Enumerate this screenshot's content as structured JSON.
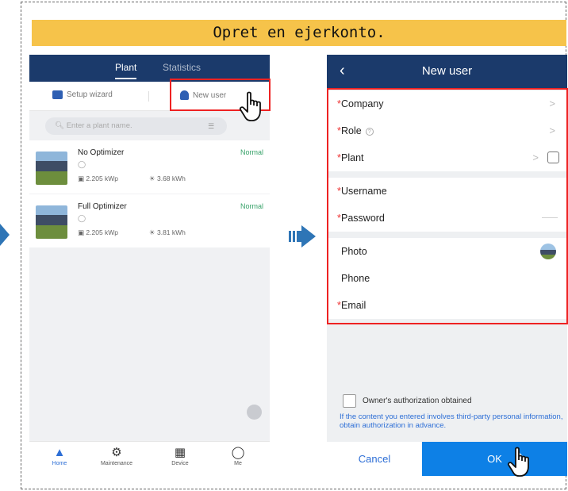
{
  "banner": {
    "title": "Opret en ejerkonto."
  },
  "colors": {
    "accent": "#1b3a6b",
    "highlight": "#e22222",
    "banner": "#f6c34a",
    "primary": "#0d80e6",
    "status_ok": "#3aa36b"
  },
  "plant_screen": {
    "tabs": [
      "Plant",
      "Statistics"
    ],
    "setup_wizard": "Setup wizard",
    "new_user": "New user",
    "search_placeholder": "Enter a plant name.",
    "plants": [
      {
        "name": "No Optimizer",
        "status": "Normal",
        "capacity": "2.205 kWp",
        "energy": "3.68 kWh"
      },
      {
        "name": "Full Optimizer",
        "status": "Normal",
        "capacity": "2.205 kWp",
        "energy": "3.81 kWh"
      }
    ],
    "nav": [
      "Home",
      "Maintenance",
      "Device",
      "Me"
    ]
  },
  "new_user_screen": {
    "title": "New user",
    "fields": {
      "company": "Company",
      "role": "Role",
      "plant": "Plant",
      "username": "Username",
      "password": "Password",
      "photo": "Photo",
      "phone": "Phone",
      "email": "Email"
    },
    "authorization": "Owner's authorization obtained",
    "note": "If the content you entered involves third-party personal information, obtain authorization in advance.",
    "cancel": "Cancel",
    "ok": "OK"
  }
}
